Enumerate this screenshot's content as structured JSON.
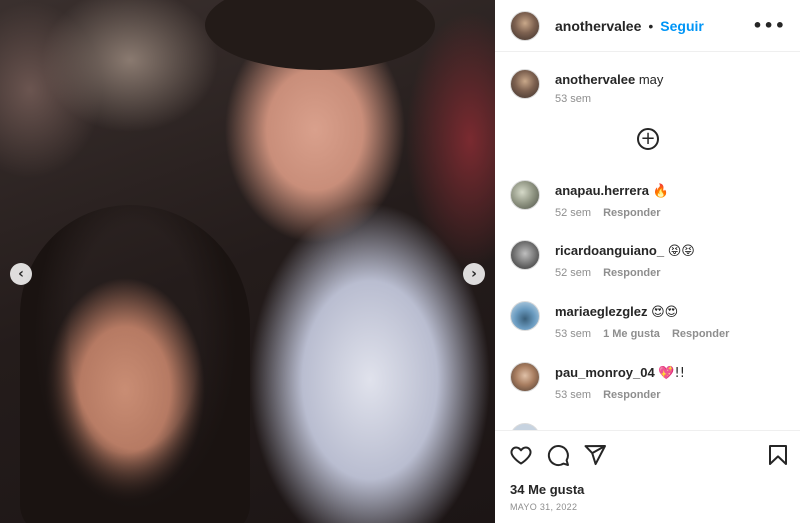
{
  "post": {
    "author": "anothervalee",
    "follow_label": "Seguir",
    "separator": "•",
    "more_label": "•••",
    "nav_prev": "‹",
    "nav_next": "›"
  },
  "caption": {
    "user": "anothervalee",
    "text": "may",
    "time": "53 sem"
  },
  "load_more_label": "+",
  "comments": [
    {
      "user": "anapau.herrera",
      "text": "🔥",
      "time": "52 sem",
      "likes": "",
      "reply": "Responder"
    },
    {
      "user": "ricardoanguiano_",
      "text": "😝😝",
      "time": "52 sem",
      "likes": "",
      "reply": "Responder"
    },
    {
      "user": "mariaeglezglez",
      "text": "😍😍",
      "time": "53 sem",
      "likes": "1 Me gusta",
      "reply": "Responder"
    },
    {
      "user": "pau_monroy_04",
      "text": "💖!!",
      "time": "53 sem",
      "likes": "",
      "reply": "Responder"
    }
  ],
  "footer": {
    "likes": "34 Me gusta",
    "date": "MAYO 31, 2022"
  },
  "icons": [
    "heart-icon",
    "comment-icon",
    "share-icon",
    "bookmark-icon",
    "more-icon",
    "plus-circle-icon",
    "chevron-left-icon",
    "chevron-right-icon"
  ]
}
